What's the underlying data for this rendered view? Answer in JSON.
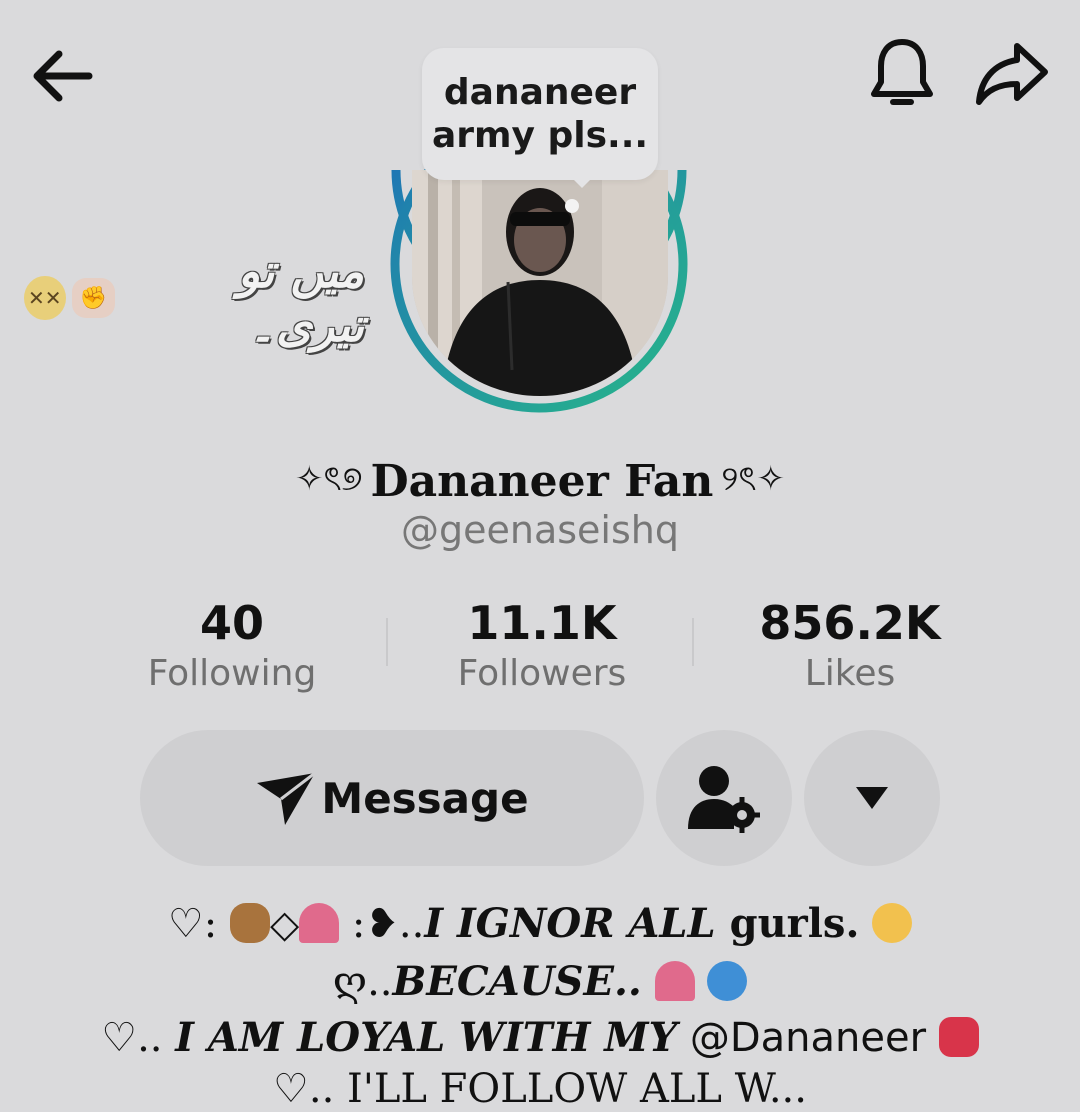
{
  "header": {
    "back_icon": "arrow-left-icon",
    "bell_icon": "bell-icon",
    "share_icon": "share-arrow-icon"
  },
  "bubble": {
    "line1": "dananeer",
    "line2": "army pls..."
  },
  "side_text": {
    "text": "میں تو تیری۔"
  },
  "profile": {
    "name_prefix": "✧ৎ୭",
    "display_name": "Dananeer Fan",
    "name_suffix": "୨ৎ✧",
    "username": "@geenaseishq",
    "ring_colors": [
      "#1f77b4",
      "#27b58a"
    ]
  },
  "stats": [
    {
      "value": "40",
      "label": "Following"
    },
    {
      "value": "11.1K",
      "label": "Followers"
    },
    {
      "value": "856.2K",
      "label": "Likes"
    }
  ],
  "actions": {
    "message_label": "Message",
    "friend_icon": "user-settings-icon",
    "more_icon": "caret-down-icon"
  },
  "bio": {
    "line1_a": "♡:",
    "line1_b": ":❥..",
    "line1_c": "I IGNOR ALL",
    "line1_d": " gurls.",
    "line2_a": "ღ..",
    "line2_b": "BECAUSE..",
    "line3_a": "♡..",
    "line3_b": "I AM LOYAL WITH MY",
    "line3_c": "@Dananeer",
    "line4": "♡.. I'LL FOLLOW ALL W..."
  }
}
